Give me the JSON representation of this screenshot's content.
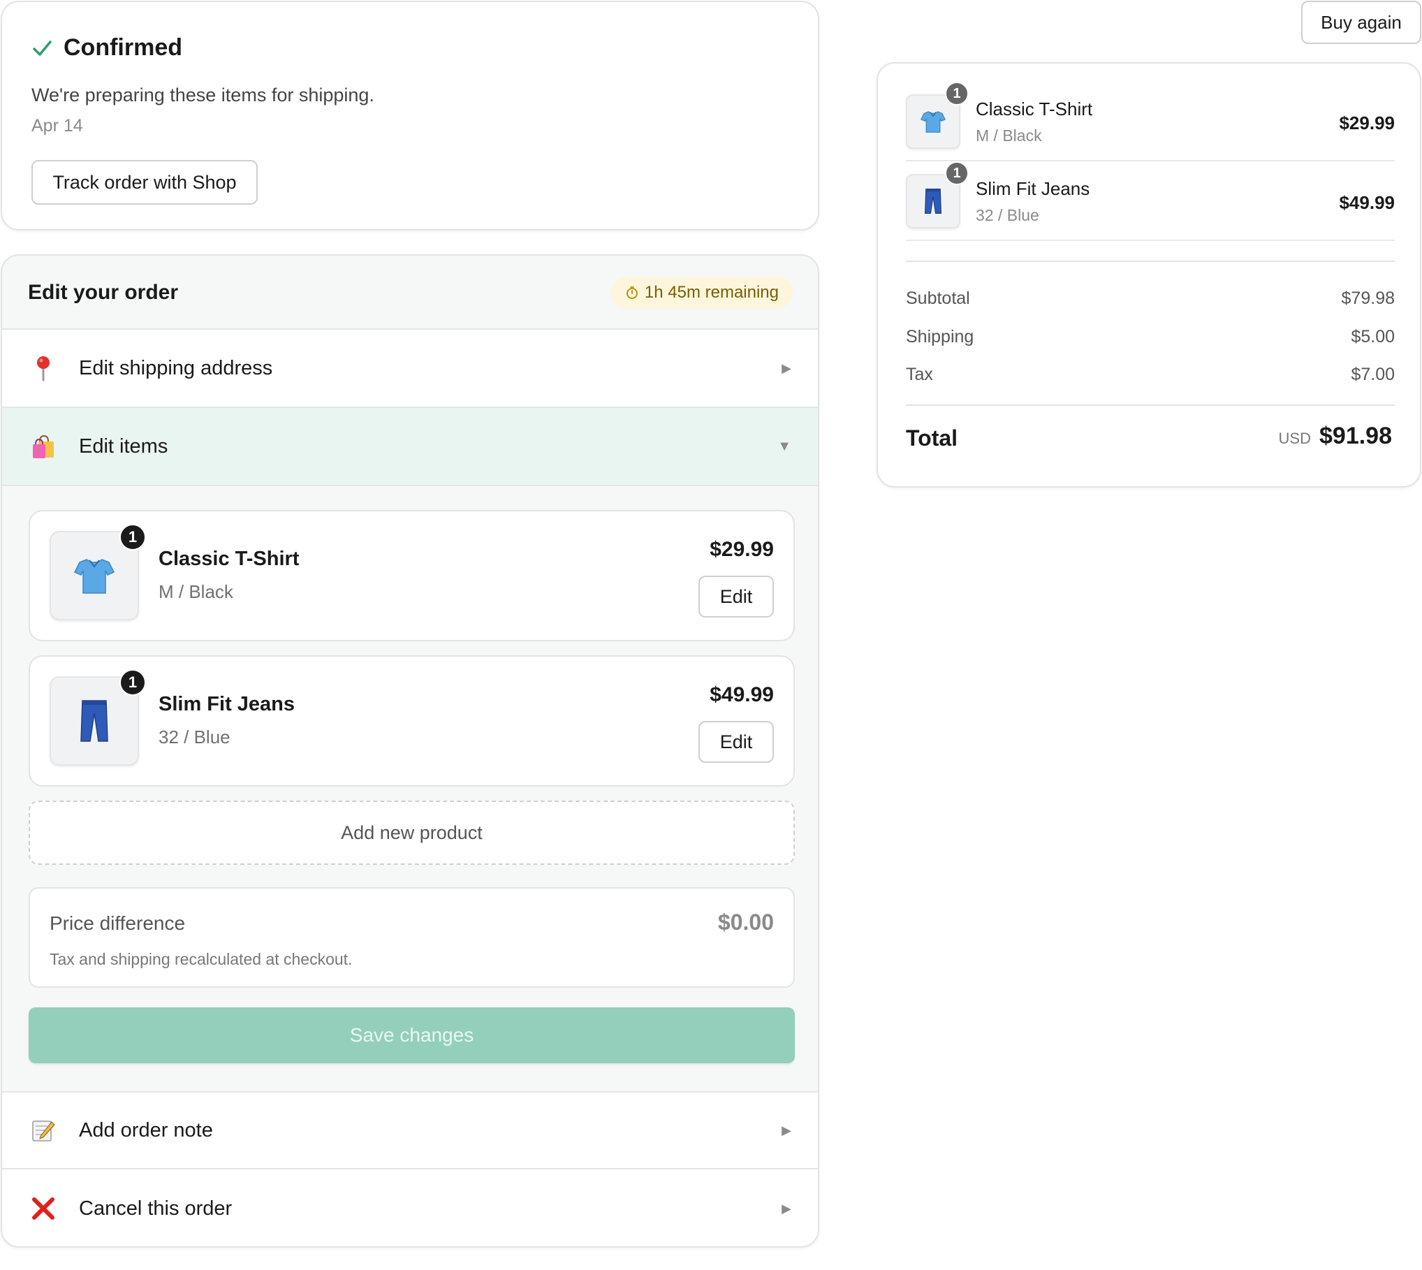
{
  "status": {
    "title": "Confirmed",
    "description": "We're preparing these items for shipping.",
    "date": "Apr 14",
    "track_label": "Track order with Shop",
    "check_color": "#2e9e6e"
  },
  "edit_order": {
    "title": "Edit your order",
    "timer": "1h 45m remaining",
    "rows": {
      "shipping": {
        "label": "Edit shipping address",
        "icon": "pin-icon"
      },
      "items": {
        "label": "Edit items",
        "icon": "shopping-bags-icon"
      },
      "note": {
        "label": "Add order note",
        "icon": "memo-icon"
      },
      "cancel": {
        "label": "Cancel this order",
        "icon": "cross-mark-icon"
      }
    },
    "items": [
      {
        "name": "Classic T-Shirt",
        "variant": "M / Black",
        "price": "$29.99",
        "qty": "1",
        "edit_label": "Edit",
        "icon": "tshirt-icon"
      },
      {
        "name": "Slim Fit Jeans",
        "variant": "32 / Blue",
        "price": "$49.99",
        "qty": "1",
        "edit_label": "Edit",
        "icon": "jeans-icon"
      }
    ],
    "add_product_label": "Add new product",
    "price_difference": {
      "label": "Price difference",
      "value": "$0.00",
      "note": "Tax and shipping recalculated at checkout."
    },
    "save_label": "Save changes",
    "save_color": "#93cfbb"
  },
  "summary": {
    "buy_again_label": "Buy again",
    "items": [
      {
        "name": "Classic T-Shirt",
        "variant": "M / Black",
        "price": "$29.99",
        "qty": "1"
      },
      {
        "name": "Slim Fit Jeans",
        "variant": "32 / Blue",
        "price": "$49.99",
        "qty": "1"
      }
    ],
    "subtotal_label": "Subtotal",
    "subtotal": "$79.98",
    "shipping_label": "Shipping",
    "shipping": "$5.00",
    "tax_label": "Tax",
    "tax": "$7.00",
    "total_label": "Total",
    "currency": "USD",
    "total": "$91.98"
  }
}
